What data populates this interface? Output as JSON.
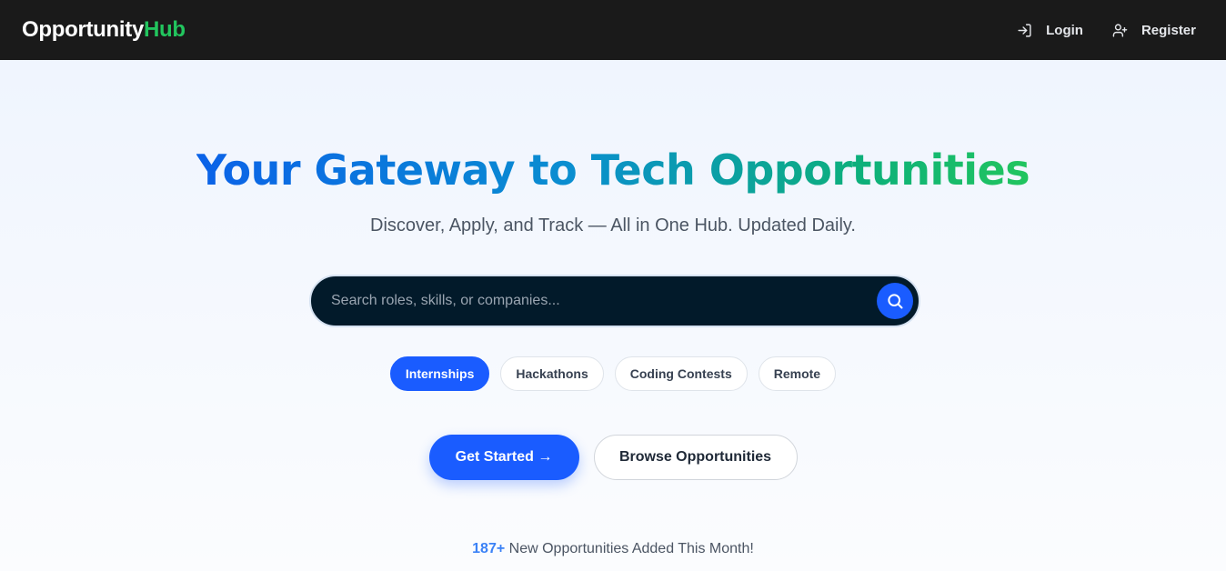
{
  "header": {
    "brand_main": "Opportunity",
    "brand_accent": "Hub",
    "login_label": "Login",
    "register_label": "Register"
  },
  "hero": {
    "title": "Your Gateway to Tech Opportunities",
    "subtitle": "Discover, Apply, and Track — All in One Hub. Updated Daily."
  },
  "search": {
    "placeholder": "Search roles, skills, or companies..."
  },
  "filters": [
    {
      "label": "Internships",
      "active": true
    },
    {
      "label": "Hackathons",
      "active": false
    },
    {
      "label": "Coding Contests",
      "active": false
    },
    {
      "label": "Remote",
      "active": false
    }
  ],
  "cta": {
    "primary_label": "Get Started →",
    "secondary_label": "Browse Opportunities"
  },
  "stats": {
    "count": "187+",
    "text": " New Opportunities Added This Month!"
  },
  "colors": {
    "accent": "#1a5cff",
    "brand_green": "#22c55e",
    "navbar": "#1a1a1a",
    "search_bg": "#021a2a"
  },
  "icons": {
    "login": "login-icon",
    "register": "add-user-icon",
    "search": "search-icon"
  }
}
